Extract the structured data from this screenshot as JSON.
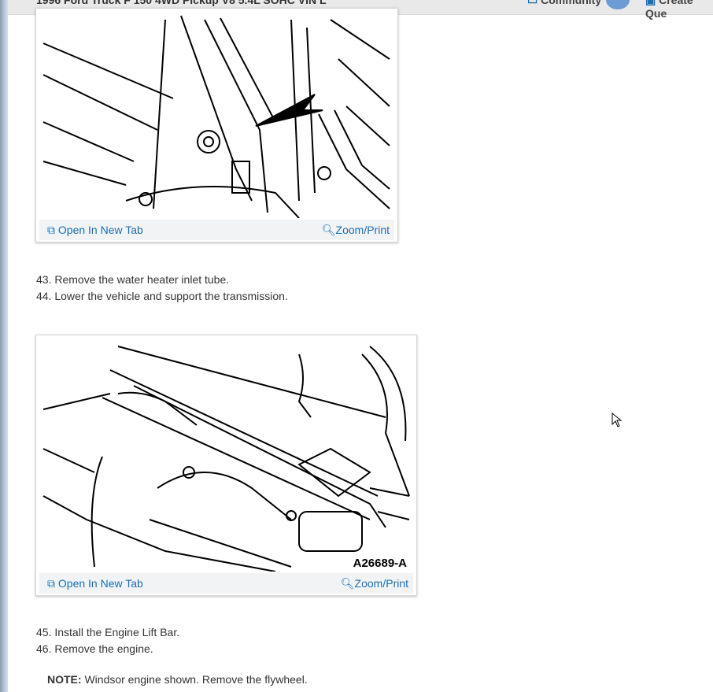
{
  "header": {
    "title": "1996 Ford Truck F 150 4WD Pickup V8 5.4L SOHC VIN L",
    "community": "Community",
    "create": "Create Que"
  },
  "figures": [
    {
      "open_label": "Open In New Tab",
      "zoom_label": "Zoom/Print",
      "caption": ""
    },
    {
      "open_label": "Open In New Tab",
      "zoom_label": "Zoom/Print",
      "caption": "A26689-A"
    }
  ],
  "steps": [
    "43. Remove the water heater inlet tube.",
    "44. Lower the vehicle and support the transmission.",
    "45. Install the Engine Lift Bar.",
    "46. Remove the engine."
  ],
  "note": {
    "label": "NOTE:",
    "text": " Windsor engine shown. Remove the flywheel."
  }
}
